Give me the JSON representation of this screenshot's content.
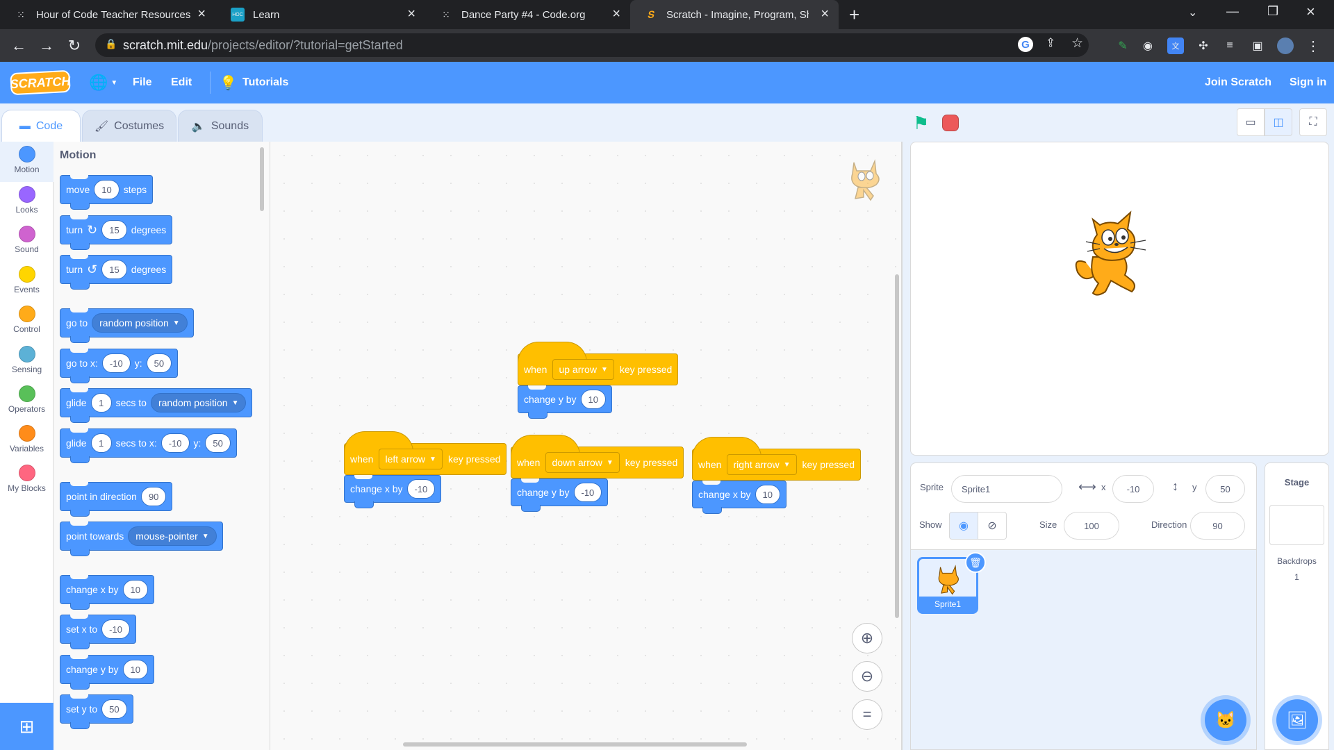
{
  "browser": {
    "tabs": [
      {
        "title": "Hour of Code Teacher Resources",
        "icon": "dots-icon"
      },
      {
        "title": "Learn",
        "icon": "hour-of-code-icon"
      },
      {
        "title": "Dance Party #4 - Code.org",
        "icon": "dots-icon"
      },
      {
        "title": "Scratch - Imagine, Program, Shar",
        "icon": "scratch-icon"
      }
    ],
    "url_host": "scratch.mit.edu",
    "url_path": "/projects/editor/?tutorial=getStarted"
  },
  "menubar": {
    "logo": "SCRATCH",
    "file": "File",
    "edit": "Edit",
    "tutorials": "Tutorials",
    "join": "Join Scratch",
    "signin": "Sign in",
    "color": "#4c97ff"
  },
  "editor_tabs": {
    "code": "Code",
    "costumes": "Costumes",
    "sounds": "Sounds"
  },
  "categories": [
    {
      "label": "Motion",
      "color": "#4c97ff"
    },
    {
      "label": "Looks",
      "color": "#9966ff"
    },
    {
      "label": "Sound",
      "color": "#cf63cf"
    },
    {
      "label": "Events",
      "color": "#ffd500"
    },
    {
      "label": "Control",
      "color": "#ffab19"
    },
    {
      "label": "Sensing",
      "color": "#5cb1d6"
    },
    {
      "label": "Operators",
      "color": "#59c059"
    },
    {
      "label": "Variables",
      "color": "#ff8c1a"
    },
    {
      "label": "My Blocks",
      "color": "#ff6680"
    }
  ],
  "palette": {
    "heading": "Motion",
    "move": {
      "a": "move",
      "v": "10",
      "b": "steps"
    },
    "turn_right": {
      "a": "turn",
      "v": "15",
      "b": "degrees"
    },
    "turn_left": {
      "a": "turn",
      "v": "15",
      "b": "degrees"
    },
    "goto": {
      "a": "go to",
      "d": "random position"
    },
    "gotoxy": {
      "a": "go to x:",
      "x": "-10",
      "b": "y:",
      "y": "50"
    },
    "glide_to": {
      "a": "glide",
      "v": "1",
      "b": "secs to",
      "d": "random position"
    },
    "glide_xy": {
      "a": "glide",
      "v": "1",
      "b": "secs to x:",
      "x": "-10",
      "c": "y:",
      "y": "50"
    },
    "point_dir": {
      "a": "point in direction",
      "v": "90"
    },
    "point_towards": {
      "a": "point towards",
      "d": "mouse-pointer"
    },
    "change_x": {
      "a": "change x by",
      "v": "10"
    },
    "set_x": {
      "a": "set x to",
      "v": "-10"
    },
    "change_y": {
      "a": "change y by",
      "v": "10"
    },
    "set_y": {
      "a": "set y to",
      "v": "50"
    }
  },
  "scripts": {
    "up": {
      "when": "when",
      "key": "up arrow",
      "pressed": "key pressed",
      "action": "change y by",
      "v": "10"
    },
    "left": {
      "when": "when",
      "key": "left arrow",
      "pressed": "key pressed",
      "action": "change x by",
      "v": "-10"
    },
    "down": {
      "when": "when",
      "key": "down arrow",
      "pressed": "key pressed",
      "action": "change y by",
      "v": "-10"
    },
    "right": {
      "when": "when",
      "key": "right arrow",
      "pressed": "key pressed",
      "action": "change x by",
      "v": "10"
    }
  },
  "sprite_info": {
    "sprite_label": "Sprite",
    "sprite_name": "Sprite1",
    "x_label": "x",
    "x": "-10",
    "y_label": "y",
    "y": "50",
    "show_label": "Show",
    "size_label": "Size",
    "size": "100",
    "direction_label": "Direction",
    "direction": "90"
  },
  "sprite_list": [
    {
      "name": "Sprite1"
    }
  ],
  "stage_panel": {
    "title": "Stage",
    "backdrops_label": "Backdrops",
    "backdrops": "1"
  }
}
